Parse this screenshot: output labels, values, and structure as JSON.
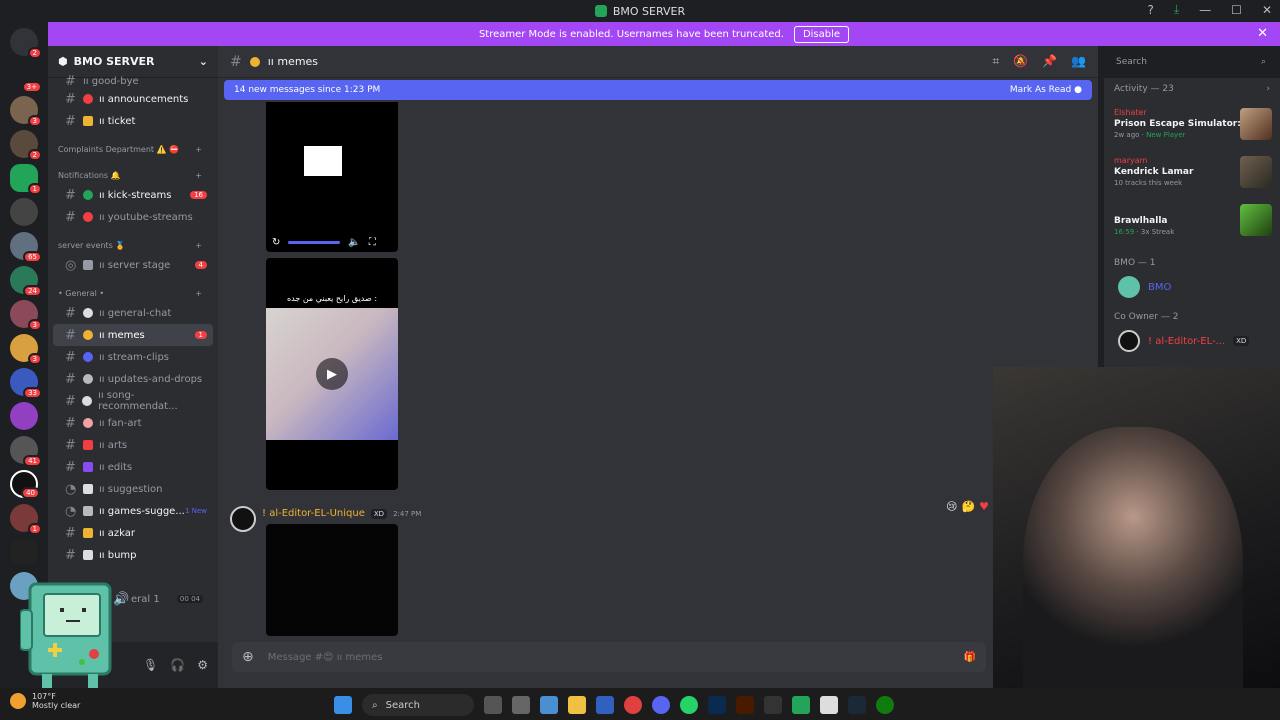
{
  "window": {
    "title": "BMO SERVER"
  },
  "banner": {
    "text": "Streamer Mode is enabled. Usernames have been truncated.",
    "button": "Disable"
  },
  "server": {
    "name": "BMO SERVER"
  },
  "channels": [
    {
      "name": "ıı good-bye",
      "unread": false
    },
    {
      "name": "ıı announcements",
      "unread": true
    },
    {
      "name": "ıı ticket",
      "unread": true
    }
  ],
  "categories": {
    "complaints": "Complaints Department ⚠️ ⛔",
    "notifications": "Notifications 🔔",
    "server_events": "server events 🏅",
    "general": "• General •"
  },
  "notif_channels": [
    {
      "name": "ıı kick-streams",
      "unread": true,
      "count": "16"
    },
    {
      "name": "ıı youtube-streams",
      "unread": false
    }
  ],
  "event_channels": [
    {
      "name": "ıı server stage",
      "count": "4"
    }
  ],
  "general_channels": [
    {
      "name": "ıı general-chat"
    },
    {
      "name": "ıı memes",
      "active": true,
      "count": "1"
    },
    {
      "name": "ıı stream-clips"
    },
    {
      "name": "ıı updates-and-drops"
    },
    {
      "name": "ıı song-recommendat..."
    },
    {
      "name": "ıı fan-art"
    },
    {
      "name": "ıı arts"
    },
    {
      "name": "ıı edits"
    },
    {
      "name": "ıı suggestion"
    },
    {
      "name": "ıı games-sugge...",
      "new": "1 New"
    },
    {
      "name": "ıı azkar",
      "unread": true
    },
    {
      "name": "ıı bump",
      "unread": true
    }
  ],
  "voice": {
    "label": "eral 1",
    "time1": "00",
    "time2": "04"
  },
  "chat": {
    "channel": "ıı memes",
    "new_messages": "14 new messages since 1:23 PM",
    "mark_read": "Mark As Read",
    "video_caption": "صديق رايح يعبني من جده :",
    "author": "! al-Editor-EL-Unique",
    "author_tag": "XD",
    "time": "2:47 PM",
    "composer_placeholder": "Message #😍 ıı memes"
  },
  "search": {
    "placeholder": "Search"
  },
  "activity": {
    "title": "Activity — 23",
    "items": [
      {
        "user": "Elshater",
        "game": "Prison Escape Simulator: D...",
        "meta1": "2w ago",
        "meta2": "New Player"
      },
      {
        "user": "maryam",
        "game": "Kendrick Lamar",
        "meta1": "10 tracks this week",
        "meta2": ""
      },
      {
        "user": "",
        "game": "Brawlhalla",
        "meta1": "16:59",
        "meta2": "3x Streak"
      }
    ]
  },
  "members": {
    "role1": "BMO — 1",
    "bmo": "BMO",
    "role2": "Co Owner — 2",
    "coowner": "! al-Editor-EL-...",
    "coowner_tag": "XD"
  },
  "taskbar": {
    "temp": "107°F",
    "weather": "Mostly clear",
    "search": "Search"
  },
  "colors": {
    "accent": "#5865f2",
    "banner": "#a347f5",
    "unread": "#f23f43"
  }
}
